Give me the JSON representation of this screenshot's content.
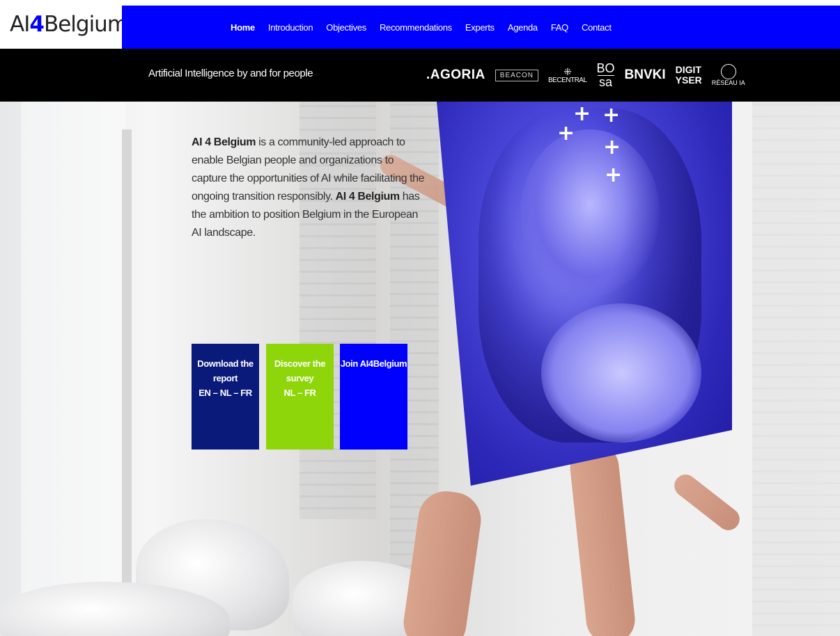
{
  "header": {
    "logo_prefix": "AI",
    "logo_four": "4",
    "logo_suffix": "Belgium",
    "nav": [
      {
        "label": "Home",
        "active": true
      },
      {
        "label": "Introduction",
        "active": false
      },
      {
        "label": "Objectives",
        "active": false
      },
      {
        "label": "Recommendations",
        "active": false
      },
      {
        "label": "Experts",
        "active": false
      },
      {
        "label": "Agenda",
        "active": false
      },
      {
        "label": "FAQ",
        "active": false
      },
      {
        "label": "Contact",
        "active": false
      }
    ]
  },
  "band": {
    "tagline": "Artificial Intelligence by and for people",
    "partners": {
      "agoria": ".AGORIA",
      "beacon": "BEACON",
      "becentral": "BECENTRAL",
      "bosa_top": "BO",
      "bosa_bottom": "sa",
      "bnvki": "BNVKI",
      "digit_top": "DIGIT",
      "digit_bottom": "YSER",
      "reseau": "RÉSEAU IA"
    }
  },
  "hero": {
    "intro_bold_1": "AI 4 Belgium",
    "intro_text_1": " is a community-led approach to enable Belgian people and organizations to capture the opportunities of AI while facilitating the ongoing transition responsibly. ",
    "intro_bold_2": "AI 4 Belgium",
    "intro_text_2": " has the ambition to position Belgium in the European AI landscape.",
    "cta": {
      "download": {
        "line1": "Download the",
        "line2": "report",
        "line3": "EN – NL – FR"
      },
      "survey": {
        "line1": "Discover the",
        "line2": "survey",
        "line3": "NL – FR"
      },
      "join": {
        "line1": "Join AI4Belgium"
      }
    }
  },
  "colors": {
    "brand_blue": "#0000ff",
    "dark_navy": "#0a1a7a",
    "lime": "#8ed60a",
    "band_black": "#000000"
  }
}
